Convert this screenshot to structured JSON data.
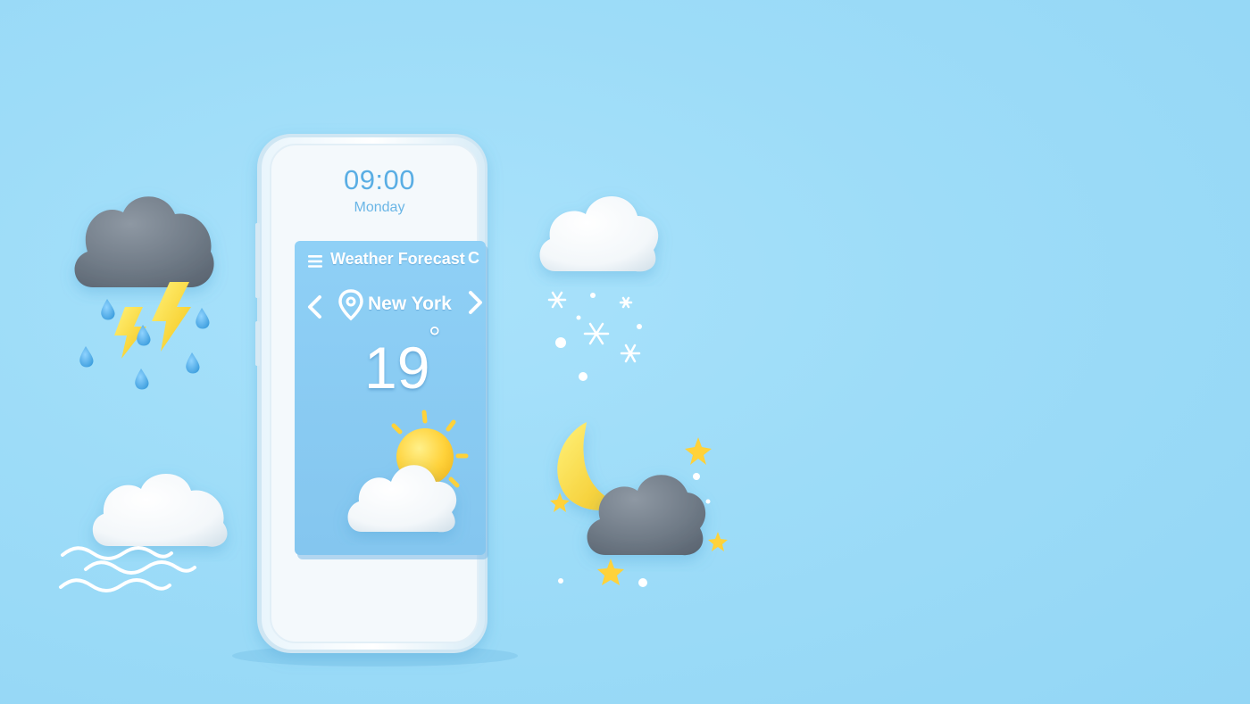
{
  "phone": {
    "time": "09:00",
    "day": "Monday"
  },
  "widget": {
    "title": "Weather Forecast",
    "city": "New York",
    "temperature": "19",
    "degree_symbol": "°",
    "refresh_glyph": "C",
    "condition_icon": "partly-sunny-icon"
  },
  "icons": [
    "thunderstorm-icon",
    "snow-icon",
    "windy-cloud-icon",
    "night-cloudy-icon"
  ],
  "colors": {
    "background": "#9ddcf8",
    "widget": "#8ccbf2",
    "accent_text": "#5aaee4",
    "sun": "#ffd23a",
    "storm_cloud": "#6f7a86"
  }
}
